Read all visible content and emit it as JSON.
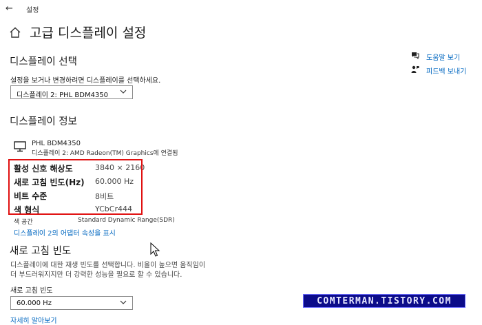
{
  "titlebar": {
    "back_glyph": "←",
    "title": "설정"
  },
  "page": {
    "title": "고급 디스플레이 설정"
  },
  "display_select": {
    "heading": "디스플레이 선택",
    "description": "설정을 보거나 변경하려면 디스플레이를 선택하세요.",
    "selected": "디스플레이 2: PHL BDM4350"
  },
  "display_info": {
    "heading": "디스플레이 정보",
    "monitor_name": "PHL BDM4350",
    "monitor_connection": "디스플레이 2: AMD Radeon(TM) Graphics에 연결됨",
    "rows": [
      {
        "label": "활성 신호 해상도",
        "value": "3840 × 2160"
      },
      {
        "label": "새로 고침 빈도(Hz)",
        "value": "60.000 Hz"
      },
      {
        "label": "비트 수준",
        "value": "8비트"
      },
      {
        "label": "색 형식",
        "value": "YCbCr444"
      },
      {
        "label": "색 공간",
        "value": "Standard Dynamic Range(SDR)"
      }
    ],
    "adapter_link": "디스플레이 2의 어댑터 속성을 표시"
  },
  "refresh": {
    "heading": "새로 고침 빈도",
    "description_line1": "디스플레이에 대한 재생 빈도를 선택합니다. 비율이 높으면 움직임이",
    "description_line2": "더 부드러워지지만 더 강력한 성능을 필요로 할 수 있습니다.",
    "label": "새로 고침 빈도",
    "selected": "60.000 Hz",
    "more_link": "자세히 알아보기"
  },
  "side_links": {
    "help": "도움말 보기",
    "feedback": "피드백 보내기"
  },
  "watermark": "COMTERMAN.TISTORY.COM",
  "colors": {
    "accent": "#0067c0",
    "highlight_border": "#e01010",
    "watermark_bg": "#0c0c8a"
  },
  "icons": [
    "back-arrow-icon",
    "home-icon",
    "chevron-down-icon",
    "monitor-icon",
    "help-chat-icon",
    "feedback-person-icon",
    "mouse-cursor-icon"
  ]
}
